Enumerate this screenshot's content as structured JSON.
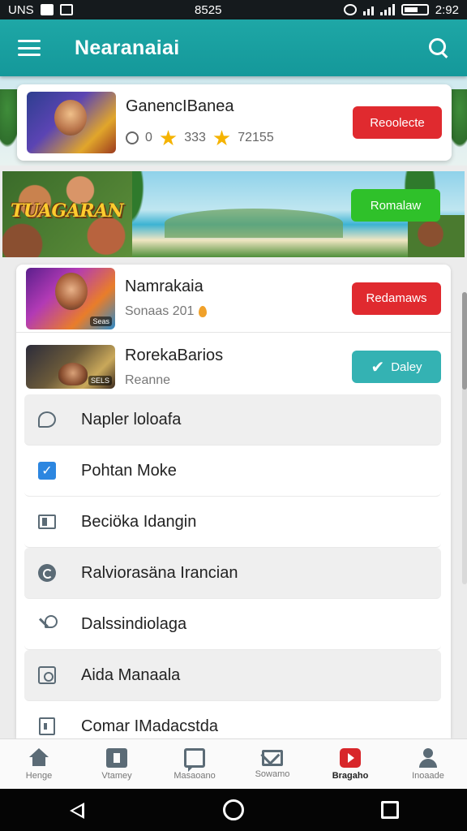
{
  "status_bar": {
    "left_text": "UNS",
    "center_time": "8525",
    "right_time": "2:92"
  },
  "app_bar": {
    "title": "Nearanaiai"
  },
  "featured": {
    "title": "GanencIBanea",
    "comments": "0",
    "rating_1": "333",
    "rating_2": "72155",
    "thumb_tag": "",
    "button_label": "Reoolecte",
    "button_color": "#e02a2f"
  },
  "banner": {
    "logo_text": "TUAGARAN",
    "button_label": "Romalaw",
    "button_color": "#2fc12a"
  },
  "games": [
    {
      "title": "Namrakaia",
      "subtitle": "Sonaas 201",
      "thumb_tag": "Seas",
      "button_label": "Redamaws",
      "button_color": "#e02a2f"
    },
    {
      "title": "RorekaBarios",
      "subtitle": "Reanne",
      "thumb_tag": "SELS",
      "button_label": "Daley",
      "button_color": "#34b2b3"
    }
  ],
  "menu_items": [
    {
      "label": "Napler loloafa",
      "icon": "chat-icon"
    },
    {
      "label": "Pohtan Moke",
      "icon": "checkbox-icon"
    },
    {
      "label": "Beciöka Idangin",
      "icon": "folder-icon"
    },
    {
      "label": "Ralviorasäna Irancian",
      "icon": "refresh-icon"
    },
    {
      "label": "Dalssindiolaga",
      "icon": "link-icon"
    },
    {
      "label": "Aida Manaala",
      "icon": "box-icon"
    },
    {
      "label": "Comar IMadacstda",
      "icon": "document-icon"
    }
  ],
  "bottom_nav": [
    {
      "label": "Henge",
      "icon": "home-icon"
    },
    {
      "label": "Vtamey",
      "icon": "bag-icon"
    },
    {
      "label": "Masaoano",
      "icon": "chat-icon"
    },
    {
      "label": "Sowamo",
      "icon": "mail-icon"
    },
    {
      "label": "Bragaho",
      "icon": "video-icon",
      "active": true
    },
    {
      "label": "Inoaade",
      "icon": "user-icon"
    }
  ],
  "colors": {
    "accent": "#1ea7a6",
    "red_button": "#e02a2f",
    "green_button": "#2fc12a",
    "teal_button": "#34b2b3"
  }
}
